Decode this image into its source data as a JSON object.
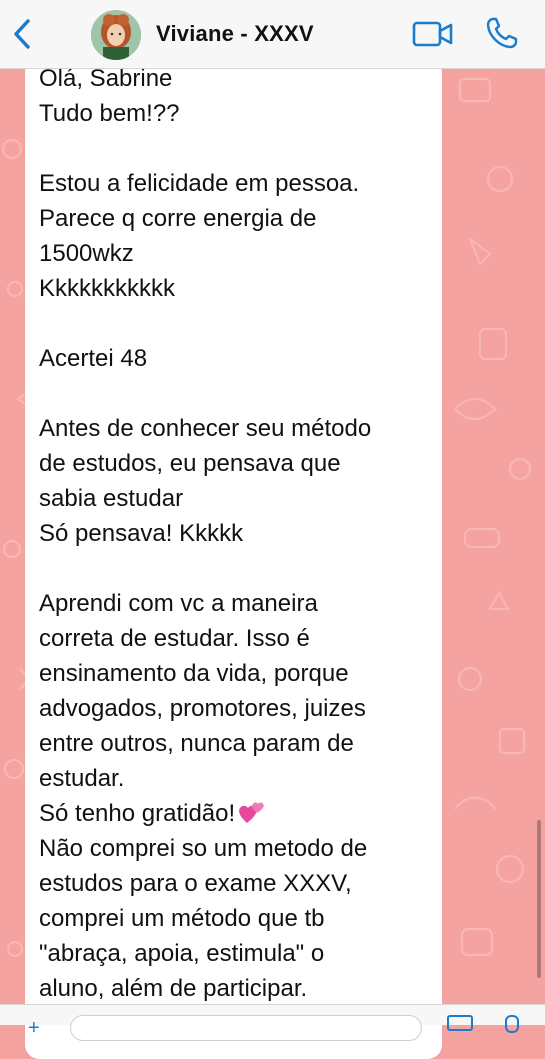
{
  "header": {
    "contact_name": "Viviane - XXXV",
    "back_icon": "chevron-left-icon",
    "video_icon": "video-call-icon",
    "phone_icon": "phone-call-icon",
    "accent_color": "#1a7ccb"
  },
  "chat": {
    "wallpaper_color": "#f5a3a1",
    "message_lines": [
      "Olá, Sabrine",
      "Tudo bem!??",
      "",
      "Estou a felicidade em pessoa.",
      "Parece q corre energia de",
      "1500wkz",
      "Kkkkkkkkkkk",
      "",
      "Acertei 48",
      "",
      "Antes de conhecer seu método",
      "de estudos, eu pensava que",
      "sabia estudar",
      "Só pensava! Kkkkk",
      "",
      "Aprendi com vc a maneira",
      "correta de estudar. Isso é",
      "ensinamento da vida, porque",
      "advogados, promotores, juizes",
      "entre outros, nunca param de",
      "estudar.",
      "Só tenho gratidão!",
      "Não comprei so um metodo de",
      "estudos para o exame XXXV,",
      "comprei um método que tb",
      "\"abraça,  apoia, estimula\" o",
      "aluno, além de participar."
    ],
    "heart_emoji": "two-hearts-emoji"
  },
  "composer": {
    "attach_icon": "plus-icon",
    "camera_icon": "camera-icon",
    "mic_icon": "microphone-icon"
  }
}
